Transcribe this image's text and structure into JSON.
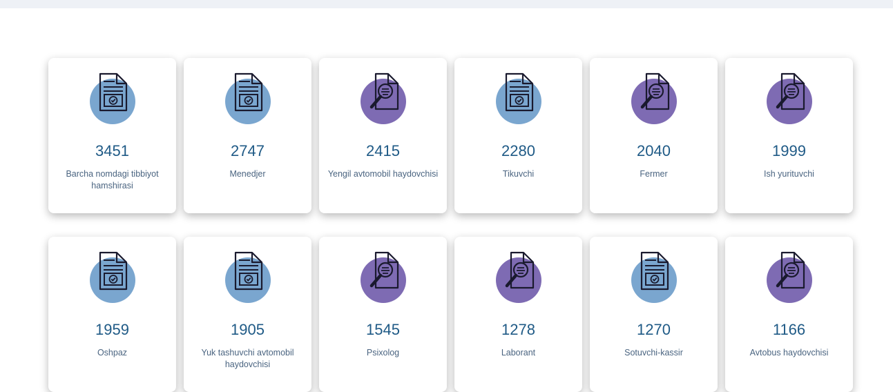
{
  "colors": {
    "doc_circle": "#7aa6cf",
    "search_circle": "#7e6bb3",
    "count_text": "#1f5a86",
    "label_text": "#4a6480"
  },
  "cards": [
    {
      "count": "3451",
      "label": "Barcha nomdagi tibbiyot hamshirasi",
      "icon": "document-check-icon"
    },
    {
      "count": "2747",
      "label": "Menedjer",
      "icon": "document-check-icon"
    },
    {
      "count": "2415",
      "label": "Yengil avtomobil haydovchisi",
      "icon": "document-search-icon"
    },
    {
      "count": "2280",
      "label": "Tikuvchi",
      "icon": "document-check-icon"
    },
    {
      "count": "2040",
      "label": "Fermer",
      "icon": "document-search-icon"
    },
    {
      "count": "1999",
      "label": "Ish yurituvchi",
      "icon": "document-search-icon"
    },
    {
      "count": "1959",
      "label": "Oshpaz",
      "icon": "document-check-icon"
    },
    {
      "count": "1905",
      "label": "Yuk tashuvchi avtomobil haydovchisi",
      "icon": "document-check-icon"
    },
    {
      "count": "1545",
      "label": "Psixolog",
      "icon": "document-search-icon"
    },
    {
      "count": "1278",
      "label": "Laborant",
      "icon": "document-search-icon"
    },
    {
      "count": "1270",
      "label": "Sotuvchi-kassir",
      "icon": "document-check-icon"
    },
    {
      "count": "1166",
      "label": "Avtobus haydovchisi",
      "icon": "document-search-icon"
    }
  ]
}
